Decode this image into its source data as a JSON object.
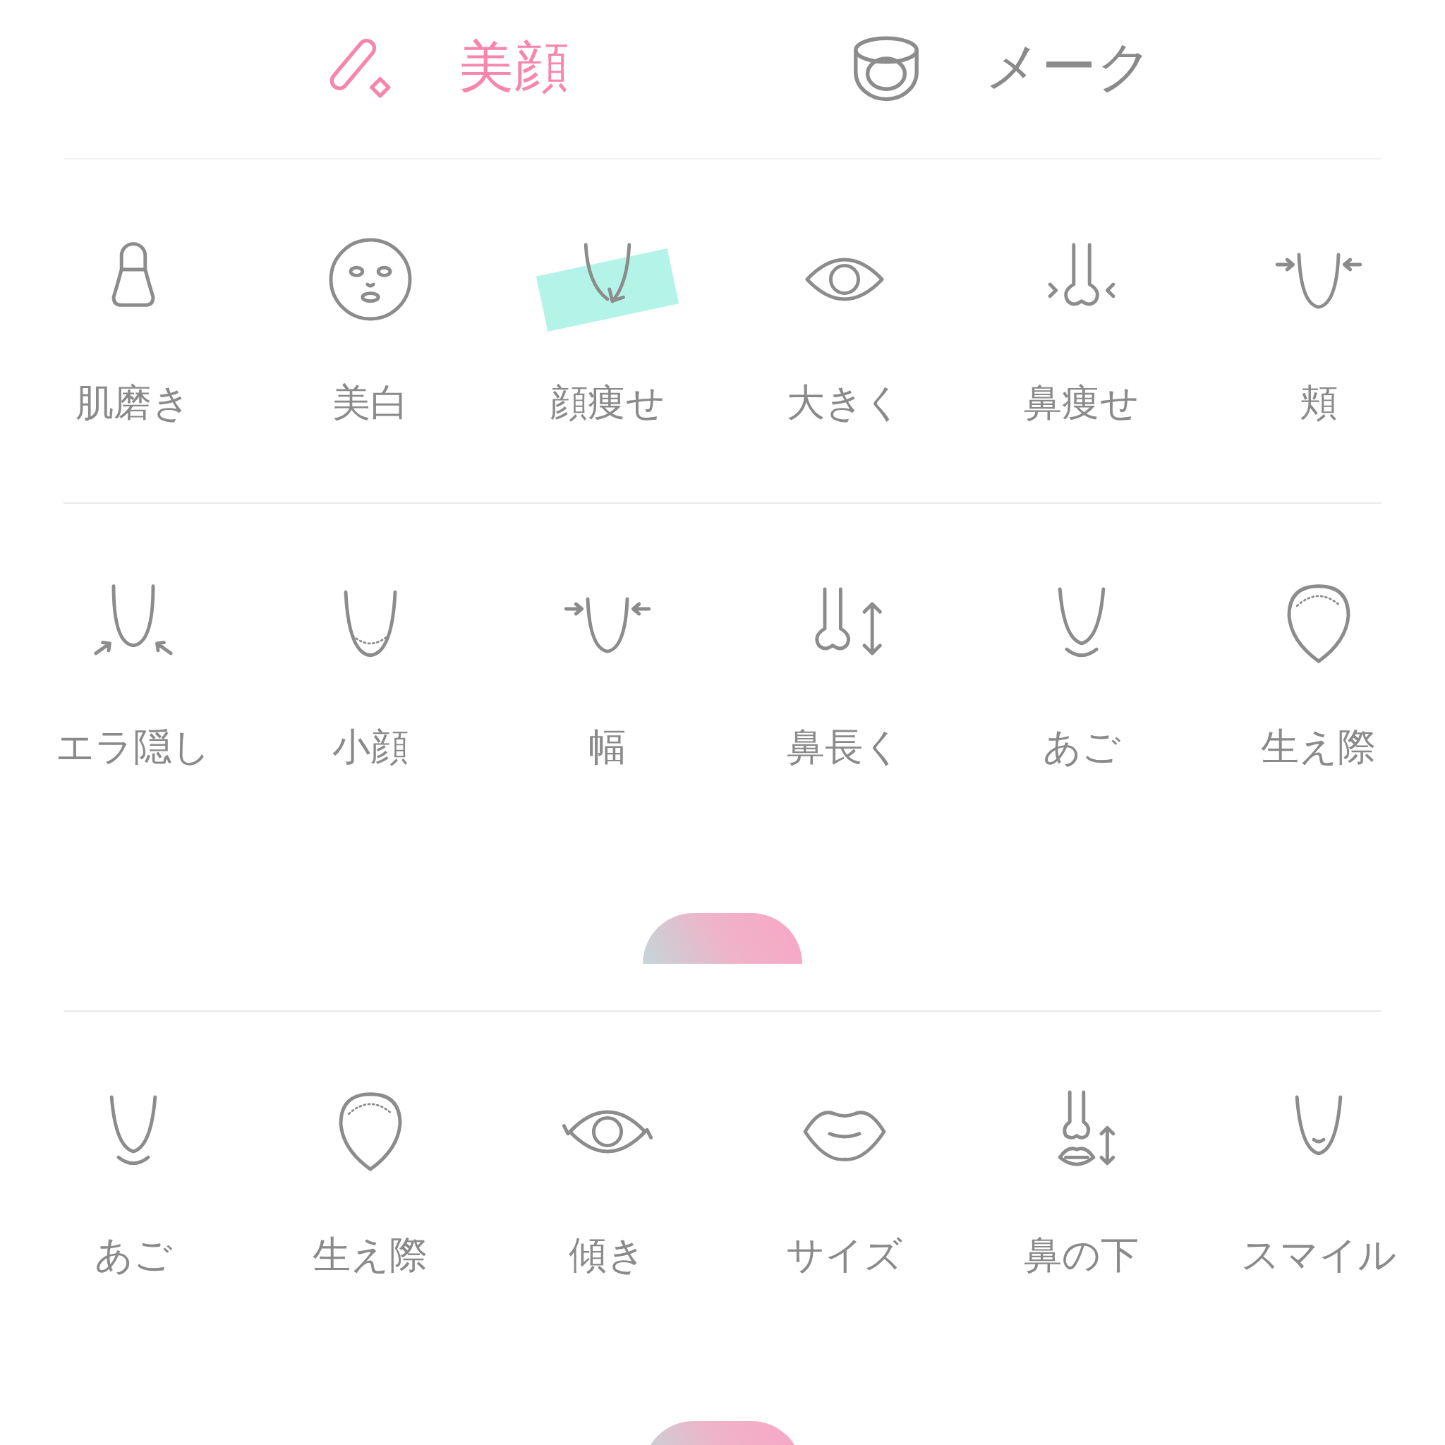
{
  "tabs": [
    {
      "label": "美顔",
      "selected": true
    },
    {
      "label": "メーク",
      "selected": false
    }
  ],
  "panels": [
    {
      "handle": false,
      "items": [
        {
          "label": "肌磨き",
          "selected": false
        },
        {
          "label": "美白",
          "selected": false
        },
        {
          "label": "顔痩せ",
          "selected": true
        },
        {
          "label": "大きく",
          "selected": false
        },
        {
          "label": "鼻痩せ",
          "selected": false
        },
        {
          "label": "頬",
          "selected": false
        }
      ]
    },
    {
      "handle": true,
      "items": [
        {
          "label": "エラ隠し",
          "selected": false
        },
        {
          "label": "小顔",
          "selected": false
        },
        {
          "label": "幅",
          "selected": false
        },
        {
          "label": "鼻長く",
          "selected": false
        },
        {
          "label": "あご",
          "selected": false
        },
        {
          "label": "生え際",
          "selected": false
        }
      ]
    },
    {
      "handle": true,
      "items": [
        {
          "label": "あご",
          "selected": false
        },
        {
          "label": "生え際",
          "selected": false
        },
        {
          "label": "傾き",
          "selected": false
        },
        {
          "label": "サイズ",
          "selected": false
        },
        {
          "label": "鼻の下",
          "selected": false
        },
        {
          "label": "スマイル",
          "selected": false
        }
      ]
    }
  ]
}
